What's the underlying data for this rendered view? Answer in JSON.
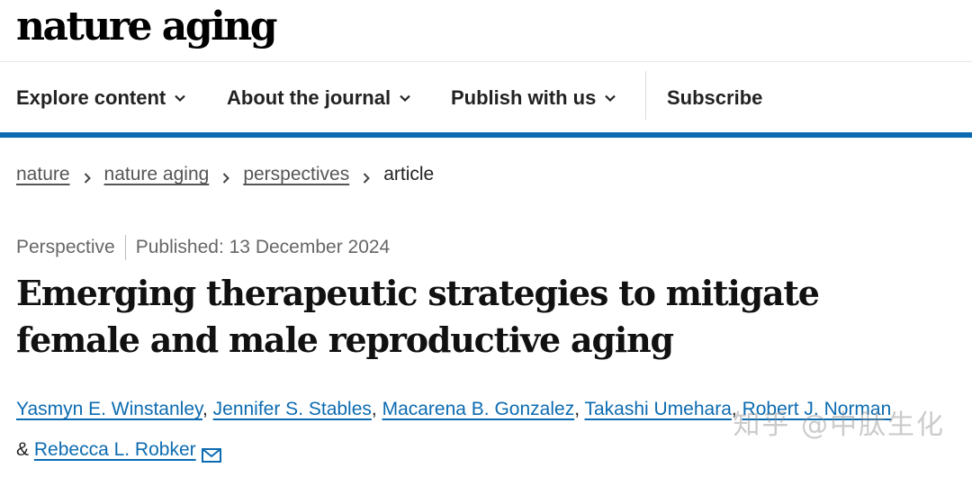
{
  "brand": {
    "logo_text": "nature aging"
  },
  "nav": {
    "explore": "Explore content",
    "about": "About the journal",
    "publish": "Publish with us",
    "subscribe": "Subscribe",
    "accent_color": "#0c6bb1"
  },
  "breadcrumb": {
    "items": [
      "nature",
      "nature aging",
      "perspectives"
    ],
    "current": "article"
  },
  "article": {
    "type": "Perspective",
    "published": "Published: 13 December 2024",
    "title": "Emerging therapeutic strategies to mitigate female and male reproductive aging",
    "authors": [
      "Yasmyn E. Winstanley",
      "Jennifer S. Stables",
      "Macarena B. Gonzalez",
      "Takashi Umehara",
      "Robert J. Norman"
    ],
    "last_author_prefix": "&",
    "last_author": "Rebecca L. Robker"
  },
  "watermark": "知乎 @中肽生化"
}
